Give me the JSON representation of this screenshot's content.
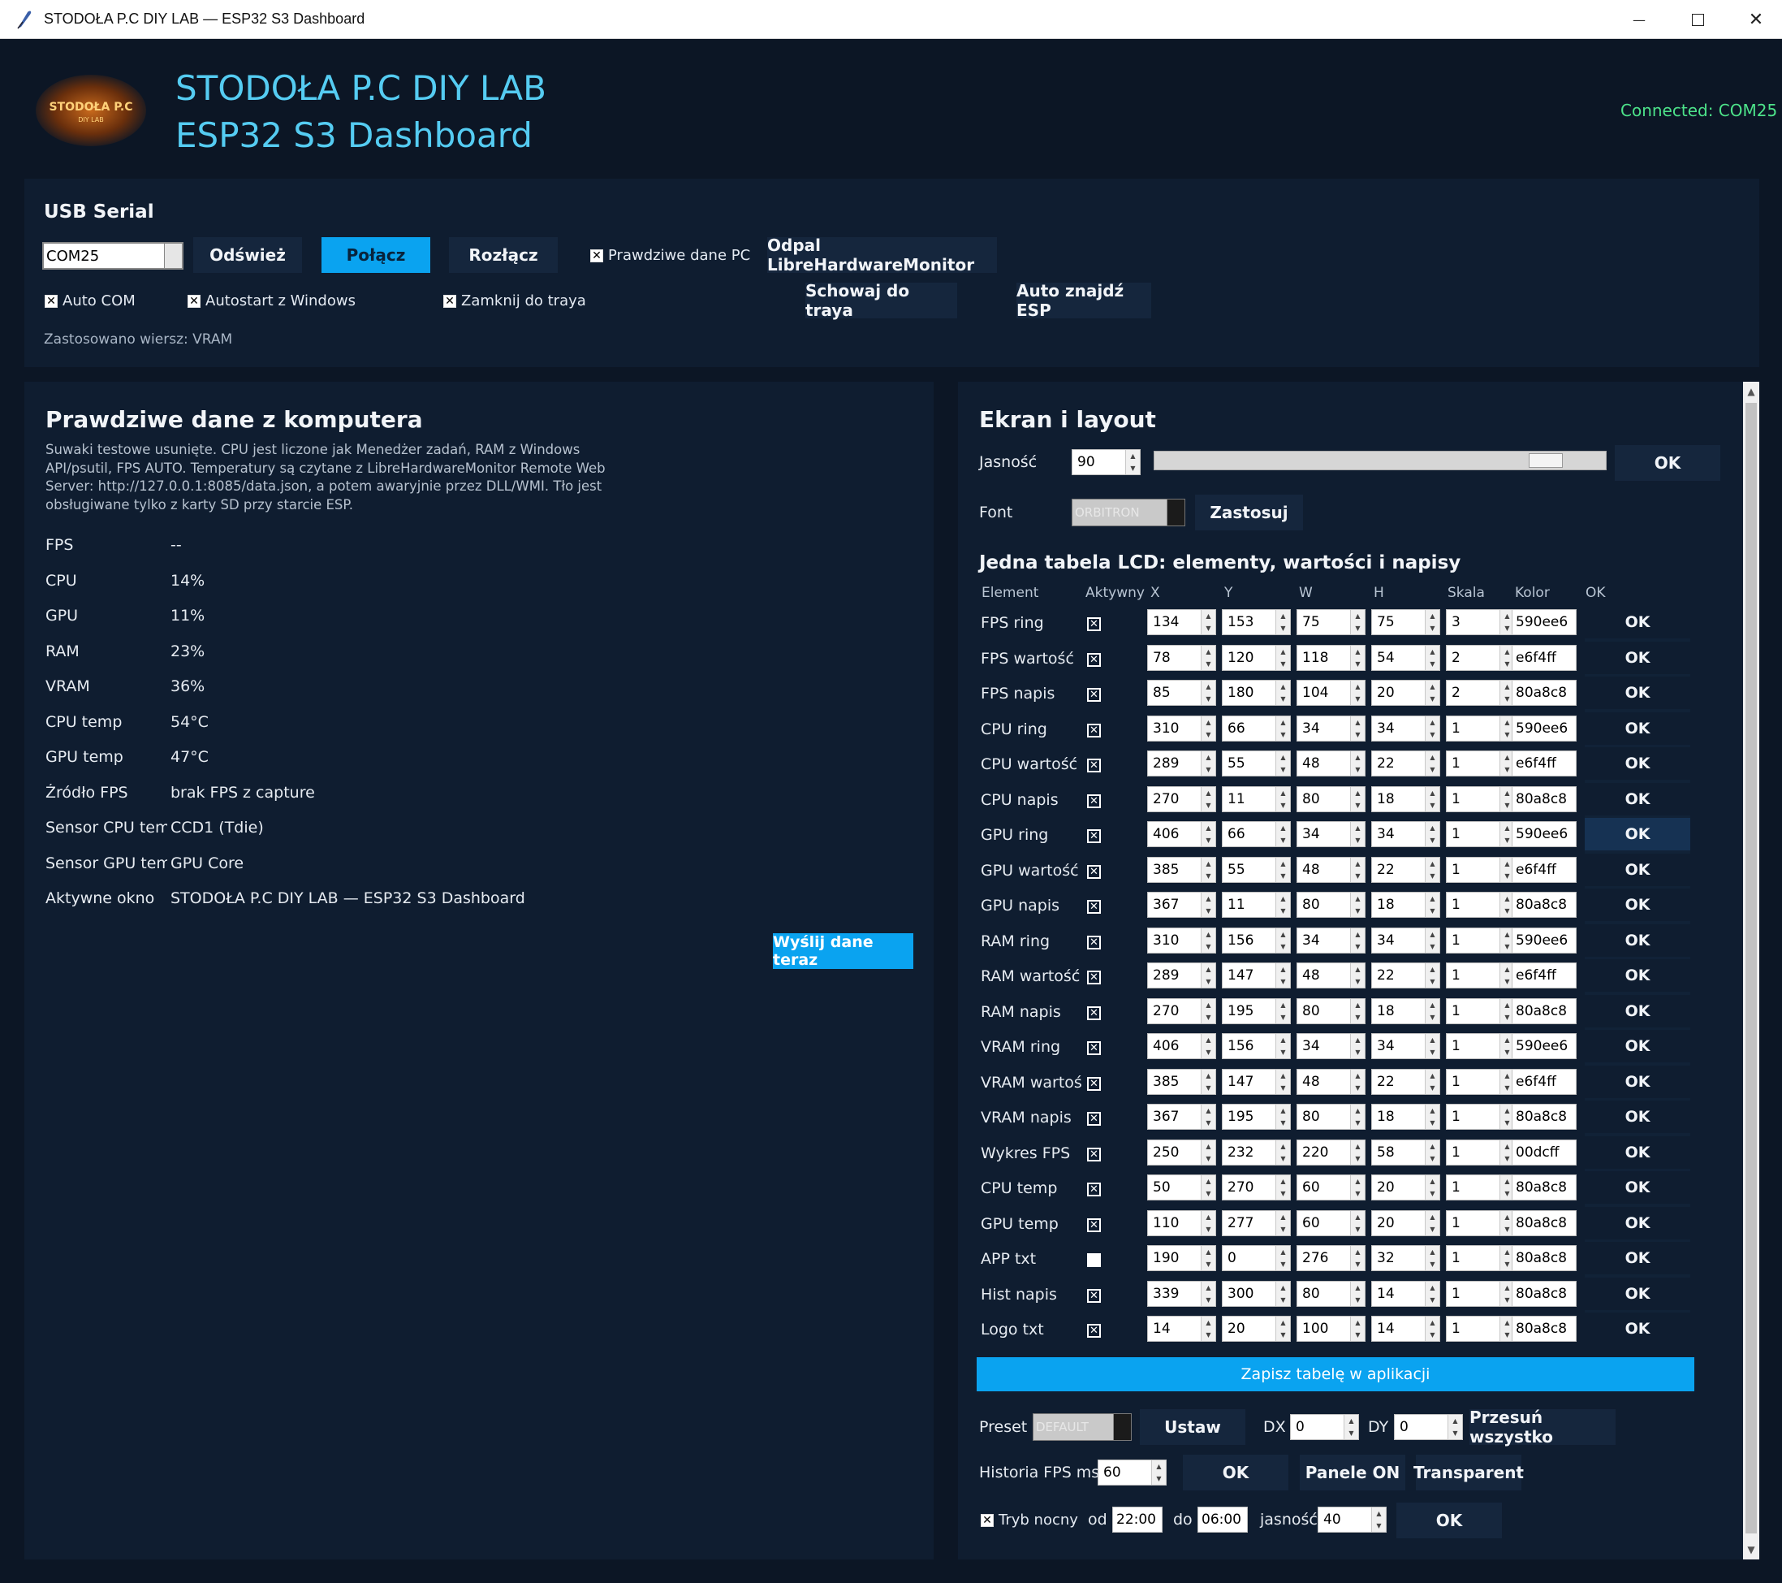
{
  "window": {
    "title": "STODOŁA P.C DIY LAB — ESP32 S3 Dashboard",
    "controls": {
      "minimize": "—",
      "close": "✕"
    }
  },
  "header": {
    "title_line1": "STODOŁA P.C DIY LAB",
    "title_line2": "ESP32 S3 Dashboard",
    "logo_text": "STODOŁA P.C",
    "logo_sub": "DIY LAB",
    "connection_status": "Connected: COM25"
  },
  "usb": {
    "section_title": "USB Serial",
    "port_value": "COM25",
    "refresh_label": "Odśwież",
    "connect_label": "Połącz",
    "disconnect_label": "Rozłącz",
    "real_pc_data_label": "Prawdziwe dane PC",
    "launch_lhm_label": "Odpal LibreHardwareMonitor",
    "auto_com_label": "Auto COM",
    "autostart_label": "Autostart z Windows",
    "close_to_tray_label": "Zamknij do traya",
    "hide_to_tray_label": "Schowaj do traya",
    "auto_find_label": "Auto znajdź ESP",
    "applied_row": "Zastosowano wiersz: VRAM"
  },
  "real_data": {
    "title": "Prawdziwe dane z komputera",
    "description": "Suwaki testowe usunięte. CPU jest liczone jak Menedżer zadań, RAM z Windows API/psutil, FPS AUTO. Temperatury są czytane z LibreHardwareMonitor Remote Web Server: http://127.0.0.1:8085/data.json, a potem awaryjnie przez DLL/WMI. Tło jest obsługiwane tylko z karty SD przy starcie ESP.",
    "rows": [
      {
        "label": "FPS",
        "value": "--"
      },
      {
        "label": "CPU",
        "value": "14%"
      },
      {
        "label": "GPU",
        "value": "11%"
      },
      {
        "label": "RAM",
        "value": "23%"
      },
      {
        "label": "VRAM",
        "value": "36%"
      },
      {
        "label": "CPU temp",
        "value": "54°C"
      },
      {
        "label": "GPU temp",
        "value": "47°C"
      },
      {
        "label": "Źródło FPS",
        "value": "brak FPS z capture"
      },
      {
        "label": "Sensor CPU temp",
        "value": "CCD1 (Tdie)"
      },
      {
        "label": "Sensor GPU temp",
        "value": "GPU Core"
      },
      {
        "label": "Aktywne okno",
        "value": "STODOŁA P.C DIY LAB — ESP32 S3 Dashboard"
      }
    ],
    "send_now_label": "Wyślij dane teraz"
  },
  "screen": {
    "title": "Ekran i layout",
    "brightness_label": "Jasność",
    "brightness_value": "90",
    "brightness_level": 0.9,
    "brightness_ok": "OK",
    "font_label": "Font",
    "font_value": "ORBITRON",
    "apply_label": "Zastosuj",
    "table_title": "Jedna tabela LCD: elementy, wartości i napisy",
    "headers": {
      "element": "Element",
      "active": "Aktywny",
      "x": "X",
      "y": "Y",
      "w": "W",
      "h": "H",
      "scale": "Skala",
      "color": "Kolor",
      "ok": "OK"
    },
    "rows": [
      {
        "name": "FPS ring",
        "active": true,
        "x": "134",
        "y": "153",
        "w": "75",
        "h": "75",
        "s": "3",
        "c": "590ee6"
      },
      {
        "name": "FPS wartość",
        "active": true,
        "x": "78",
        "y": "120",
        "w": "118",
        "h": "54",
        "s": "2",
        "c": "e6f4ff"
      },
      {
        "name": "FPS napis",
        "active": true,
        "x": "85",
        "y": "180",
        "w": "104",
        "h": "20",
        "s": "2",
        "c": "80a8c8"
      },
      {
        "name": "CPU ring",
        "active": true,
        "x": "310",
        "y": "66",
        "w": "34",
        "h": "34",
        "s": "1",
        "c": "590ee6"
      },
      {
        "name": "CPU wartość",
        "active": true,
        "x": "289",
        "y": "55",
        "w": "48",
        "h": "22",
        "s": "1",
        "c": "e6f4ff"
      },
      {
        "name": "CPU napis",
        "active": true,
        "x": "270",
        "y": "11",
        "w": "80",
        "h": "18",
        "s": "1",
        "c": "80a8c8"
      },
      {
        "name": "GPU ring",
        "active": true,
        "x": "406",
        "y": "66",
        "w": "34",
        "h": "34",
        "s": "1",
        "c": "590ee6"
      },
      {
        "name": "GPU wartość",
        "active": true,
        "x": "385",
        "y": "55",
        "w": "48",
        "h": "22",
        "s": "1",
        "c": "e6f4ff"
      },
      {
        "name": "GPU napis",
        "active": true,
        "x": "367",
        "y": "11",
        "w": "80",
        "h": "18",
        "s": "1",
        "c": "80a8c8"
      },
      {
        "name": "RAM ring",
        "active": true,
        "x": "310",
        "y": "156",
        "w": "34",
        "h": "34",
        "s": "1",
        "c": "590ee6"
      },
      {
        "name": "RAM wartość",
        "active": true,
        "x": "289",
        "y": "147",
        "w": "48",
        "h": "22",
        "s": "1",
        "c": "e6f4ff"
      },
      {
        "name": "RAM napis",
        "active": true,
        "x": "270",
        "y": "195",
        "w": "80",
        "h": "18",
        "s": "1",
        "c": "80a8c8"
      },
      {
        "name": "VRAM ring",
        "active": true,
        "x": "406",
        "y": "156",
        "w": "34",
        "h": "34",
        "s": "1",
        "c": "590ee6"
      },
      {
        "name": "VRAM wartość",
        "active": true,
        "x": "385",
        "y": "147",
        "w": "48",
        "h": "22",
        "s": "1",
        "c": "e6f4ff"
      },
      {
        "name": "VRAM napis",
        "active": true,
        "x": "367",
        "y": "195",
        "w": "80",
        "h": "18",
        "s": "1",
        "c": "80a8c8"
      },
      {
        "name": "Wykres FPS",
        "active": true,
        "x": "250",
        "y": "232",
        "w": "220",
        "h": "58",
        "s": "1",
        "c": "00dcff"
      },
      {
        "name": "CPU temp",
        "active": true,
        "x": "50",
        "y": "270",
        "w": "60",
        "h": "20",
        "s": "1",
        "c": "80a8c8"
      },
      {
        "name": "GPU temp",
        "active": true,
        "x": "110",
        "y": "277",
        "w": "60",
        "h": "20",
        "s": "1",
        "c": "80a8c8"
      },
      {
        "name": "APP txt",
        "active": false,
        "x": "190",
        "y": "0",
        "w": "276",
        "h": "32",
        "s": "1",
        "c": "80a8c8"
      },
      {
        "name": "Hist napis",
        "active": true,
        "x": "339",
        "y": "300",
        "w": "80",
        "h": "14",
        "s": "1",
        "c": "80a8c8"
      },
      {
        "name": "Logo txt",
        "active": true,
        "x": "14",
        "y": "20",
        "w": "100",
        "h": "14",
        "s": "1",
        "c": "80a8c8"
      }
    ],
    "row_ok_label": "OK",
    "save_table_label": "Zapisz tabelę w aplikacji",
    "preset_label": "Preset",
    "preset_value": "DEFAULT",
    "set_label": "Ustaw",
    "dx_label": "DX",
    "dx_value": "0",
    "dy_label": "DY",
    "dy_value": "0",
    "shift_all_label": "Przesuń wszystko",
    "fps_history_label": "Historia FPS ms",
    "fps_history_value": "60",
    "fps_history_ok": "OK",
    "panels_on_label": "Panele ON",
    "transparent_label": "Transparent",
    "night_mode_label": "Tryb nocny",
    "from_label": "od",
    "from_value": "22:00",
    "to_label": "do",
    "to_value": "06:00",
    "night_brightness_label": "jasność",
    "night_brightness_value": "40",
    "night_ok": "OK"
  },
  "colors": {
    "accent": "#0aa3f0",
    "title": "#55ccf2",
    "connected": "#4de38a",
    "background": "#0c1625",
    "panel": "#0f1d30"
  }
}
